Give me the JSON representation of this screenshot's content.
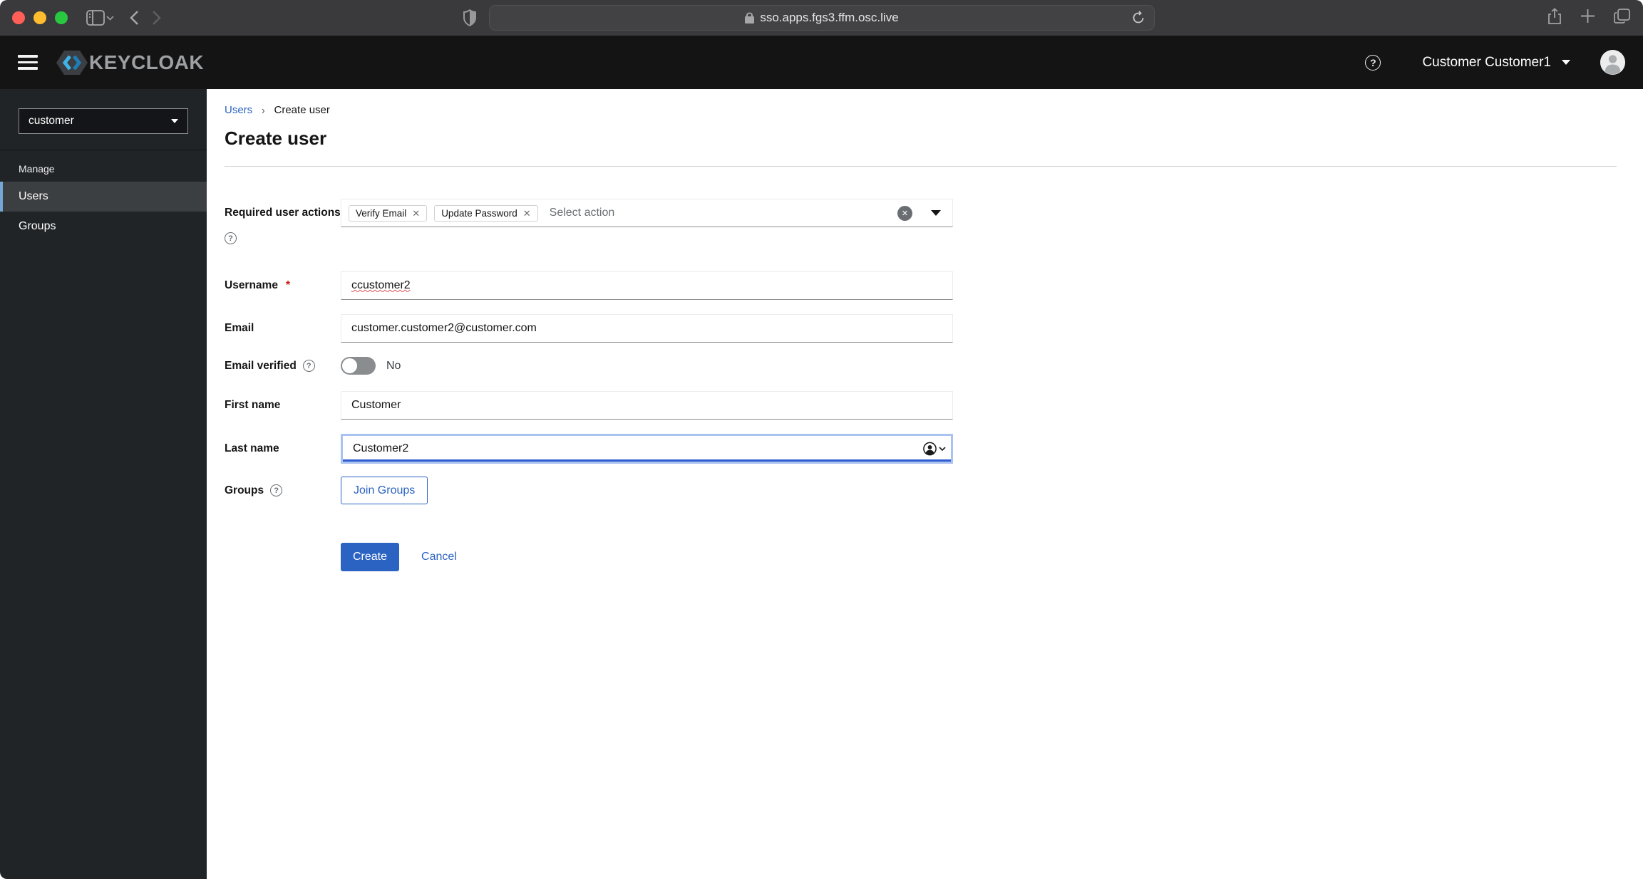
{
  "colors": {
    "primary_blue": "#2b63c2",
    "masthead_bg": "#141414",
    "sidebar_bg": "#212427",
    "sidebar_selected_bg": "#3c3f42",
    "sidebar_accent": "#76a6d5",
    "traffic_red": "#ff5f57",
    "traffic_yellow": "#febc2e",
    "traffic_green": "#28c840",
    "toggle_off_gray": "#8a8d90",
    "required_asterisk": "#c9190b"
  },
  "browser": {
    "address": "sso.apps.fgs3.ffm.osc.live",
    "icons": [
      "traffic-lights",
      "sidebar-toggle",
      "back",
      "forward",
      "shield",
      "lock",
      "reload",
      "share",
      "new-tab",
      "tab-overview"
    ]
  },
  "header": {
    "brand": "KEYCLOAK",
    "user_name": "Customer Customer1"
  },
  "sidebar": {
    "realm": "customer",
    "section": "Manage",
    "items": [
      {
        "label": "Users",
        "selected": true
      },
      {
        "label": "Groups",
        "selected": false
      }
    ]
  },
  "breadcrumb": {
    "parent": "Users",
    "current": "Create user"
  },
  "page": {
    "title": "Create user"
  },
  "form": {
    "required_actions": {
      "label": "Required user actions",
      "chips": [
        {
          "label": "Verify Email"
        },
        {
          "label": "Update Password"
        }
      ],
      "placeholder": "Select action"
    },
    "username": {
      "label": "Username",
      "value": "ccustomer2",
      "required": "*"
    },
    "email": {
      "label": "Email",
      "value": "customer.customer2@customer.com"
    },
    "email_verified": {
      "label": "Email verified",
      "value": "No"
    },
    "first_name": {
      "label": "First name",
      "value": "Customer"
    },
    "last_name": {
      "label": "Last name",
      "value": "Customer2"
    },
    "groups": {
      "label": "Groups",
      "join_button": "Join Groups"
    },
    "actions": {
      "create": "Create",
      "cancel": "Cancel"
    }
  }
}
